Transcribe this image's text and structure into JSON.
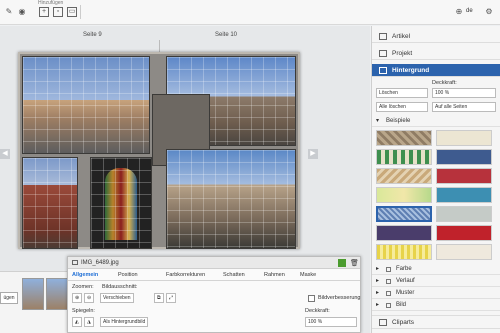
{
  "toolbar": {
    "insert_label": "Hinzufügen",
    "language": "de"
  },
  "canvas": {
    "page_left": "Seite 9",
    "page_right": "Seite 10"
  },
  "thumbnails": {
    "button_label": "ügen"
  },
  "photo_panel": {
    "filename": "IMG_6489.jpg",
    "tabs": [
      "Allgemein",
      "Position",
      "Farbkorrekturen",
      "Schatten",
      "Rahmen",
      "Maske"
    ],
    "zoom_label": "Zoomen:",
    "crop_label": "Bildausschnitt:",
    "move_label": "Verschieben",
    "mirror_label": "Spiegeln:",
    "as_background_label": "Als Hintergrundbild",
    "enhance_label": "Bildverbesserung",
    "opacity_label": "Deckkraft:",
    "opacity_value": "100 %"
  },
  "sidebar": {
    "sections": {
      "article": "Artikel",
      "project": "Projekt",
      "background": "Hintergrund",
      "cliparts": "Cliparts"
    },
    "opacity_label": "Deckkraft:",
    "delete_label": "Löschen",
    "opacity_value": "100 %",
    "delete_all_label": "Alle löschen",
    "apply_all_label": "Auf alle Seiten",
    "examples_label": "Beispiele",
    "subsections": [
      "Farbe",
      "Verlauf",
      "Muster",
      "Bild"
    ]
  },
  "colors": {
    "accent": "#2c63ad",
    "panel_tab_active": "#1f6fd6"
  }
}
